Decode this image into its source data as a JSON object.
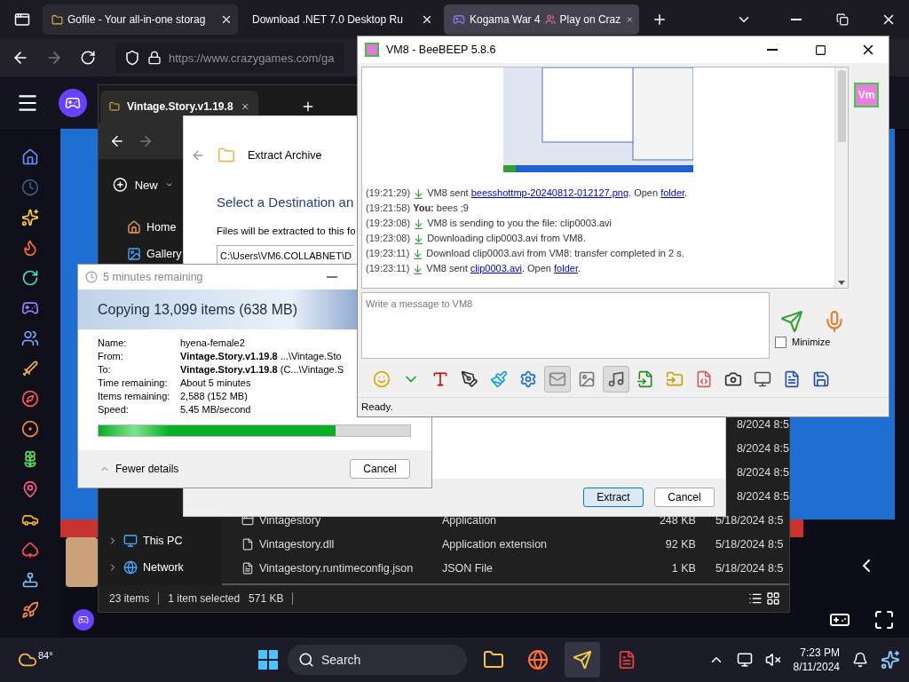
{
  "browser": {
    "tabs": [
      {
        "label": "Gofile - Your all-in-one storag",
        "selected": false,
        "hovered": true
      },
      {
        "label": "Download .NET 7.0 Desktop Ru",
        "selected": false,
        "hovered": false
      },
      {
        "label": "Kogama War 4",
        "label_2": "Play on Craz",
        "selected": true,
        "hovered": false
      }
    ],
    "url": "https://www.crazygames.com/ga"
  },
  "explorer": {
    "tab_title": "Vintage.Story.v1.19.8",
    "new_button": "New",
    "nav_top": [
      {
        "label": "Home",
        "expandable": false
      },
      {
        "label": "Gallery",
        "expandable": false
      }
    ],
    "nav_bottom": [
      {
        "label": "This PC",
        "expandable": true
      },
      {
        "label": "Network",
        "expandable": true
      }
    ],
    "rows": [
      {
        "date": "8/2024 8:5"
      },
      {
        "date": "8/2024 8:5"
      },
      {
        "date": "8/2024 8:5"
      },
      {
        "date": "8/2024 8:5"
      },
      {
        "kind": "app",
        "name": "Vintagestory",
        "type": "Application",
        "size": "248 KB",
        "date": "5/18/2024 8:5"
      },
      {
        "kind": "dll",
        "name": "Vintagestory.dll",
        "type": "Application extension",
        "size": "92 KB",
        "date": "5/18/2024 8:5"
      },
      {
        "kind": "json",
        "name": "Vintagestory.runtimeconfig.json",
        "type": "JSON File",
        "size": "1 KB",
        "date": "5/18/2024 8:5"
      }
    ],
    "status": {
      "count": "23 items",
      "selection": "1 item selected",
      "size": "571 KB"
    }
  },
  "extract": {
    "title": "Extract Archive",
    "heading": "Select a Destination an",
    "description": "Files will be extracted to this fo",
    "path": "C:\\Users\\VM6.COLLABNET\\D",
    "buttons": [
      {
        "label": "Extract",
        "default": true
      },
      {
        "label": "Cancel",
        "default": false
      }
    ]
  },
  "copy": {
    "title": "5 minutes remaining",
    "heading": "Copying 13,099 items (638 MB)",
    "details": [
      {
        "label": "Name:",
        "value": "hyena-female2"
      },
      {
        "label": "From:",
        "value": "**Vintage.Story.v1.19.8** ...\\Vintage.Sto"
      },
      {
        "label": "To:",
        "value": "**Vintage.Story.v1.19.8** (C...\\Vintage.S"
      },
      {
        "label": "Time remaining:",
        "value": "About 5 minutes"
      },
      {
        "label": "Items remaining:",
        "value": "2,588 (152 MB)"
      },
      {
        "label": "Speed:",
        "value": "5.45 MB/second"
      }
    ],
    "level": 0.76,
    "toggle": "Fewer details",
    "cancel": "Cancel"
  },
  "chat": {
    "title": "VM8 - BeeBEEP 5.8.6",
    "avatar": "Vm",
    "messages": [
      {
        "time": "(19:21:29)",
        "kind": "file",
        "parts": [
          {
            "kind": "text",
            "text": "VM8 sent "
          },
          {
            "kind": "link",
            "text": "beesshottmp-20240812-012127.png"
          },
          {
            "kind": "text",
            "text": ". Open "
          },
          {
            "kind": "link",
            "text": "folder"
          },
          {
            "kind": "text",
            "text": "."
          }
        ]
      },
      {
        "time": "(19:21:58)",
        "kind": "chat",
        "parts": [
          {
            "kind": "text",
            "text": "**You:** bees ;9"
          }
        ]
      },
      {
        "time": "(19:23:08)",
        "kind": "file",
        "parts": [
          {
            "kind": "text",
            "text": "VM8 is sending to you the file: clip0003.avi"
          }
        ]
      },
      {
        "time": "(19:23:08)",
        "kind": "file",
        "parts": [
          {
            "kind": "text",
            "text": "Downloading clip0003.avi from VM8."
          }
        ]
      },
      {
        "time": "(19:23:11)",
        "kind": "file",
        "parts": [
          {
            "kind": "text",
            "text": "Download clip0003.avi from VM8: transfer completed in 2 s."
          }
        ]
      },
      {
        "time": "(19:23:11)",
        "kind": "file",
        "parts": [
          {
            "kind": "text",
            "text": "VM8 sent "
          },
          {
            "kind": "link",
            "text": "clip0003.avi"
          },
          {
            "kind": "text",
            "text": ". Open "
          },
          {
            "kind": "link",
            "text": "folder"
          },
          {
            "kind": "text",
            "text": "."
          }
        ]
      }
    ],
    "placeholder": "Write a message to VM8",
    "minimize": {
      "label": "Minimize",
      "checked": false
    },
    "toolbar": [
      {
        "pressed": false
      },
      {
        "pressed": false
      },
      {
        "pressed": false
      },
      {
        "pressed": false
      },
      {
        "pressed": false
      },
      {
        "pressed": false
      },
      {
        "pressed": true
      },
      {
        "pressed": false
      },
      {
        "pressed": true
      },
      {
        "pressed": false
      },
      {
        "pressed": false
      },
      {
        "pressed": false
      },
      {
        "pressed": false
      },
      {
        "pressed": false
      },
      {
        "pressed": false
      },
      {
        "pressed": false
      }
    ],
    "status": "Ready."
  },
  "taskbar": {
    "weather": "84°",
    "search": "Search",
    "time": "7:23 PM",
    "date": "8/11/2024"
  }
}
